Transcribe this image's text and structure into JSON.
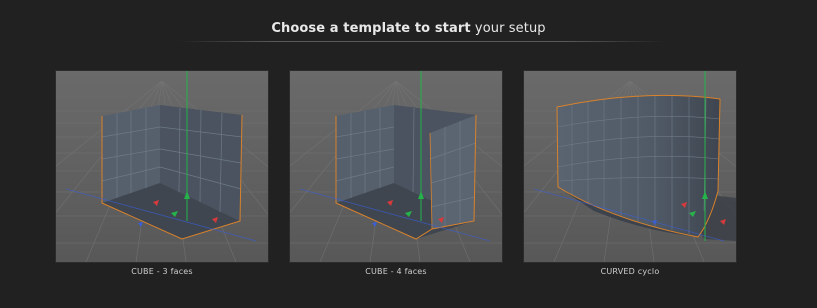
{
  "header": {
    "title_bold": "Choose a template to start",
    "title_rest": "your setup"
  },
  "templates": [
    {
      "label": "CUBE - 3 faces"
    },
    {
      "label": "CUBE - 4 faces"
    },
    {
      "label": "CURVED cyclo"
    }
  ],
  "colors": {
    "background": "#212121",
    "viewport": "#5e5e5e",
    "wall": "#4e5764",
    "grid": "#6e6e6e",
    "edge_highlight": "#d9822b",
    "axis_y": "#25b34a",
    "axis_x": "#d63a3a",
    "axis_z": "#3a5fd6"
  }
}
